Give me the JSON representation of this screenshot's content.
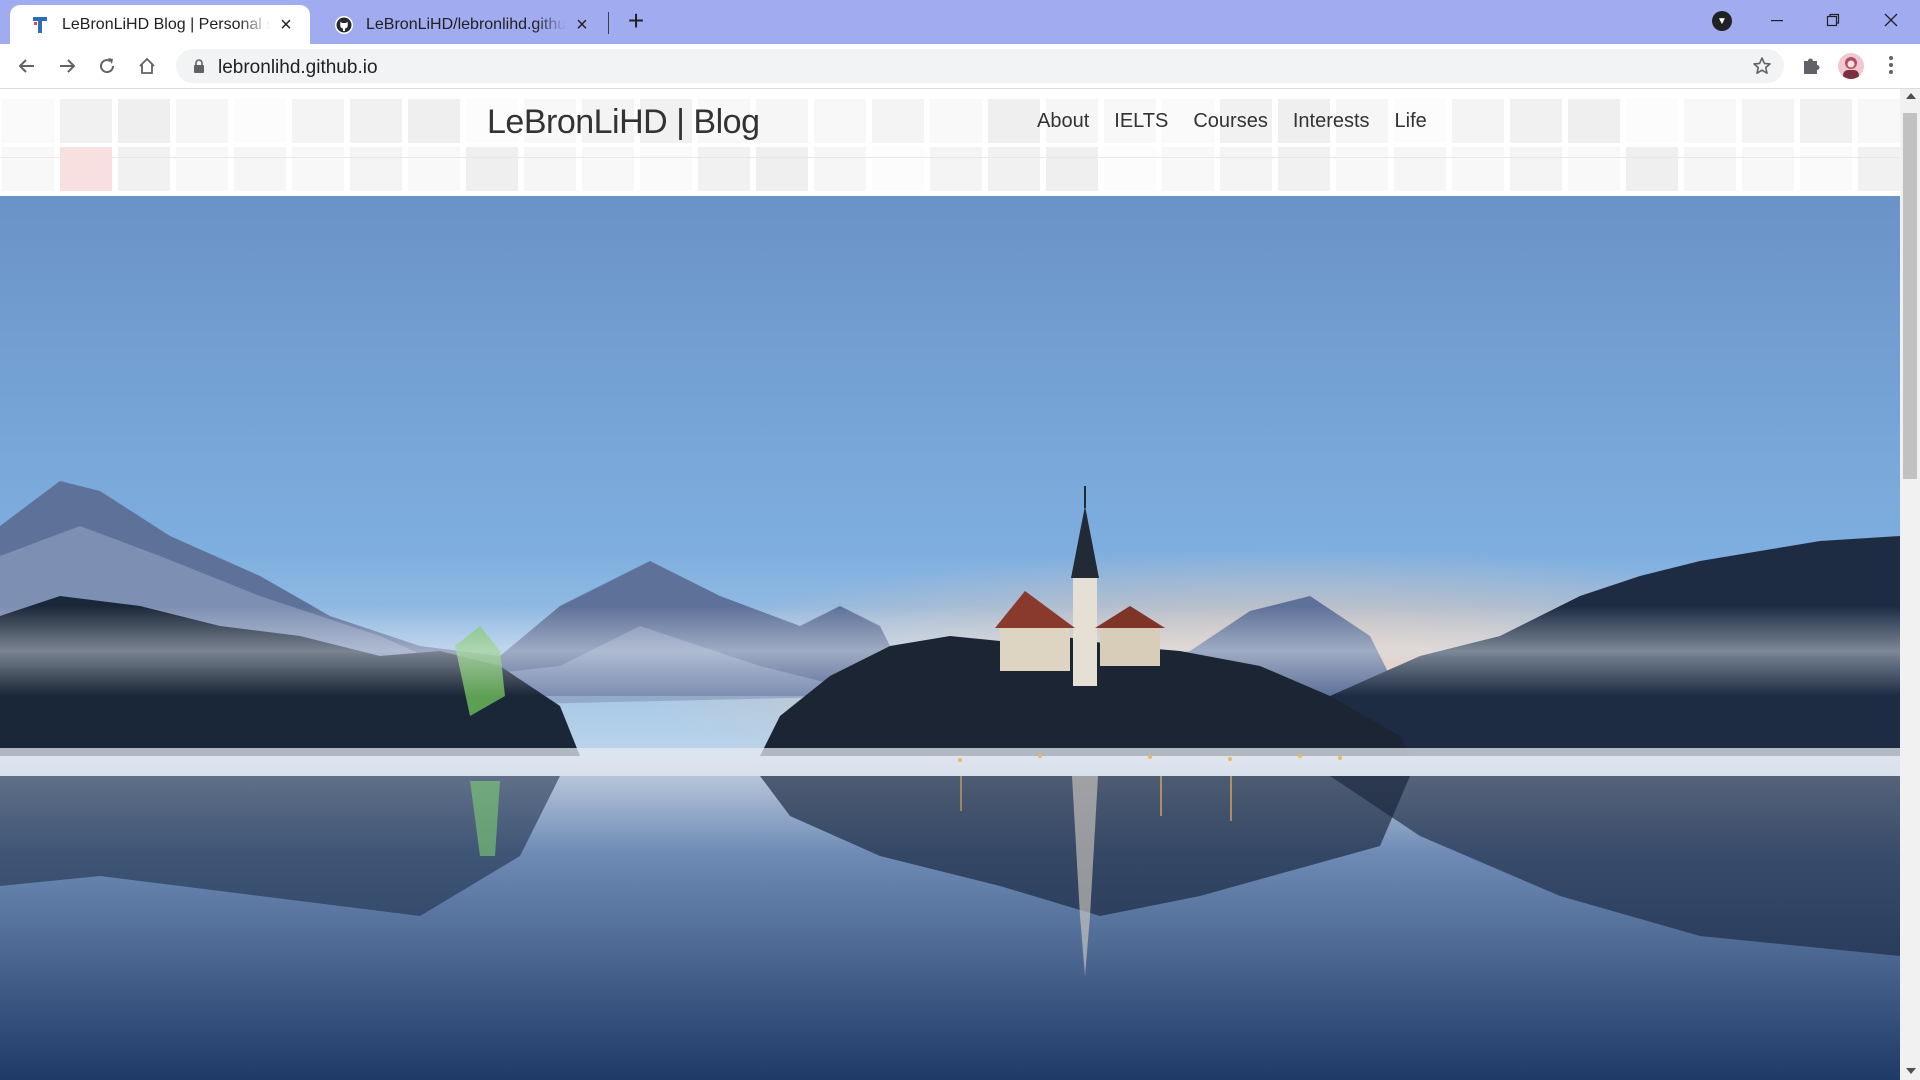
{
  "browser": {
    "tabs": [
      {
        "title": "LeBronLiHD Blog | Personal static website",
        "active": true,
        "favicon": "blog-favicon-icon"
      },
      {
        "title": "LeBronLiHD/lebronlihd.github.io",
        "active": false,
        "favicon": "github-icon"
      }
    ],
    "new_tab_symbol": "+",
    "close_symbol": "×",
    "url": "lebronlihd.github.io",
    "colors": {
      "tabstrip": "#a1abf0",
      "omnibox": "#f1f3f4"
    }
  },
  "site": {
    "brand": "LeBronLiHD | Blog",
    "nav": [
      "About",
      "IELTS",
      "Courses",
      "Interests",
      "Life"
    ]
  },
  "hero": {
    "description_icon": "lake-bled-landscape-photo",
    "colors": {
      "sky_top": "#6a93c7",
      "sky_horizon": "#f2d2c1",
      "water": "#3b5a86"
    }
  }
}
